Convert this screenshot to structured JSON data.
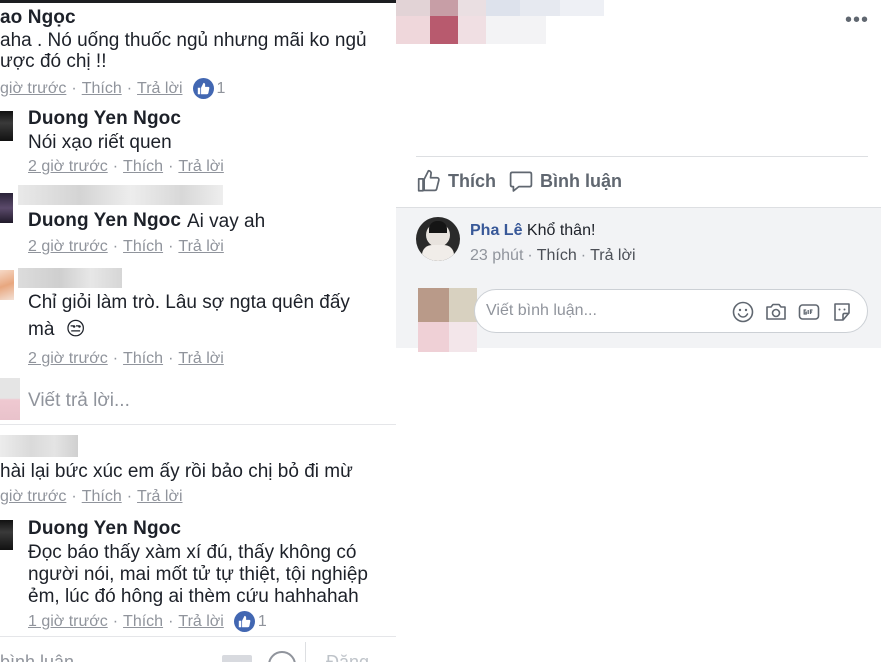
{
  "left": {
    "c1": {
      "name": "ao Ngọc",
      "line1": "aha . Nó uống thuốc ngủ nhưng mãi ko ngủ",
      "line2": "ược đó chị !!",
      "time": "giờ trước",
      "like": "Thích",
      "reply": "Trả lời",
      "like_count": "1"
    },
    "r1": {
      "name": "Duong Yen Ngoc",
      "text": "Nói xạo riết quen",
      "time": "2 giờ trước",
      "like": "Thích",
      "reply": "Trả lời"
    },
    "r2": {
      "name": "Duong Yen Ngoc",
      "text": "Ai vay ah",
      "time": "2 giờ trước",
      "like": "Thích",
      "reply": "Trả lời"
    },
    "r3": {
      "line1": "Chỉ giỏi làm trò. Lâu sợ ngta quên đấy",
      "line2": "mà",
      "emoji": "😒",
      "time": "2 giờ trước",
      "like": "Thích",
      "reply": "Trả lời"
    },
    "reply_placeholder": "Viết trả lời...",
    "c2": {
      "text": "hài lại bức xúc em ấy rồi bảo chị bỏ đi mừ",
      "time": "giờ trước",
      "like": "Thích",
      "reply": "Trả lời"
    },
    "r4": {
      "name": "Duong Yen Ngoc",
      "line1": "Đọc báo thấy xàm xí đú, thấy không có",
      "line2": "người nói, mai mốt tử tự thiệt, tội nghiệp",
      "line3": "ẻm, lúc đó hông ai thèm cứu hahhahah",
      "time": "1 giờ trước",
      "like": "Thích",
      "reply": "Trả lời",
      "like_count": "1"
    },
    "bottom_placeholder": "bình luận",
    "bottom_post": "Đăng"
  },
  "right": {
    "more": "•••",
    "like_action": "Thích",
    "comment_action": "Bình luận",
    "comment": {
      "name": "Pha Lê",
      "text": "Khổ thân!",
      "time": "23 phút",
      "like": "Thích",
      "reply": "Trả lời"
    },
    "write_placeholder": "Viết bình luận..."
  },
  "colors": {
    "link_blue": "#385898",
    "meta_gray": "#90949c",
    "like_blue": "#4267b2",
    "comment_bg": "#f2f3f5"
  }
}
